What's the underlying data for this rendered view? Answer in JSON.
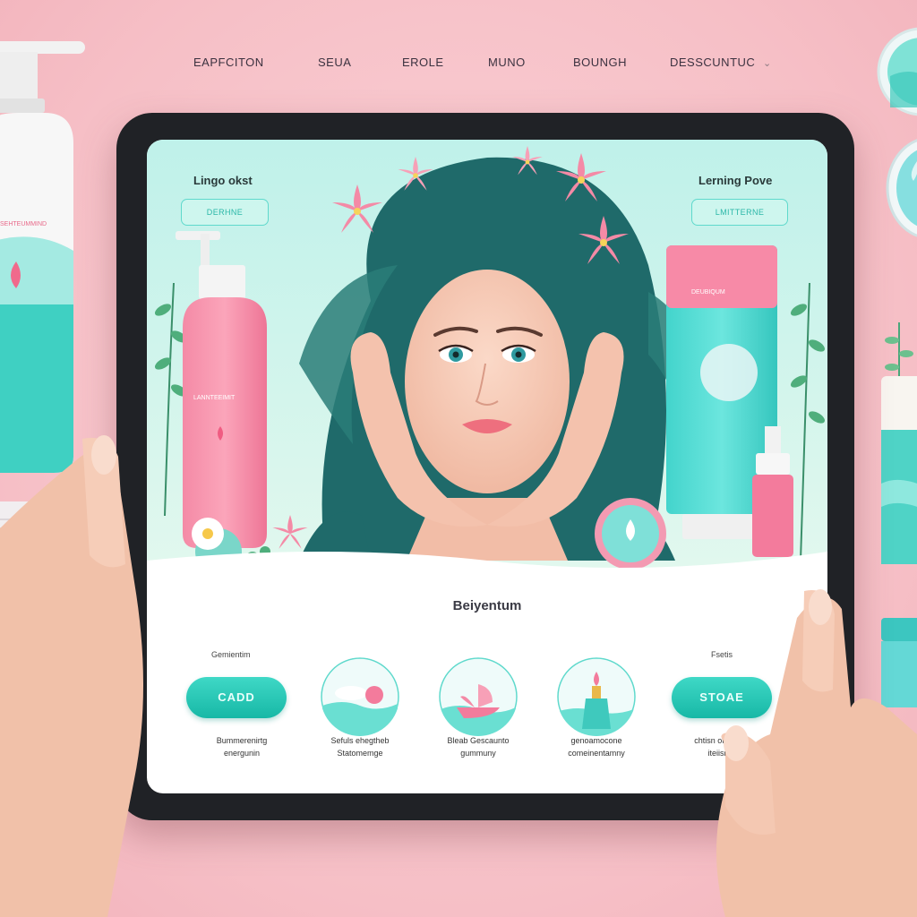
{
  "top_nav": {
    "items": [
      "EAPFCITON",
      "SEUA",
      "EROLE",
      "MUNO",
      "BOUNGH",
      "DESSCUNTUC"
    ],
    "chevron": "⌄"
  },
  "hero": {
    "left_label": "Lingo okst",
    "left_button": "DERHNE",
    "right_label": "Lerning Pove",
    "right_button": "LMITTERNE"
  },
  "section": {
    "title": "Beiyentum"
  },
  "features": {
    "left_label": "Gemientim",
    "right_label": "Fsetis",
    "left_cta": "CADD",
    "right_cta": "STOAE",
    "captions": [
      [
        "Bummerenirtg",
        "energunin"
      ],
      [
        "Sefuls ehegtheb",
        "Statomemge"
      ],
      [
        "Bleab Gescaunto",
        "gummuny"
      ],
      [
        "genoamocone",
        "comeinentamny"
      ],
      [
        "chtisn ot dom",
        "iteiisn"
      ]
    ]
  },
  "products": {
    "pump_bottle_label": "LANNTEEIMIT",
    "tube_label": "DEUBIQUM",
    "bg_bottle_label": "SEHTEUMMIND"
  },
  "colors": {
    "teal": "#22c2b0",
    "pink": "#f37b9c",
    "background": "#f6c1c8",
    "tablet_frame": "#202226"
  },
  "icons": [
    "chevron-down-icon",
    "water-drop-icon",
    "leaf-icon",
    "flower-icon",
    "cream-jar-icon",
    "boat-icon",
    "serum-dropper-icon"
  ]
}
